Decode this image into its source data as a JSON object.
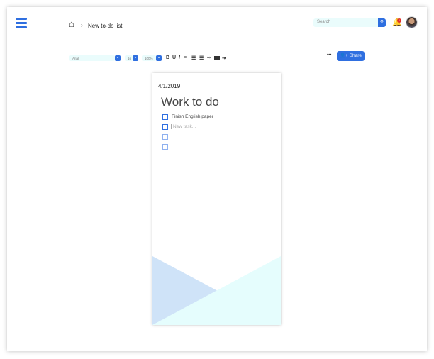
{
  "header": {
    "breadcrumb": "New to-do list",
    "search_placeholder": "Search",
    "notification_count": "1"
  },
  "toolbar": {
    "font": "Arial",
    "size": "16",
    "zoom": "100%",
    "bold": "B",
    "underline": "U",
    "italic": "I",
    "more": "•••",
    "share": "Share"
  },
  "doc": {
    "date": "4/1/2019",
    "title": "Work to do",
    "tasks": [
      {
        "text": "Finish English paper"
      },
      {
        "text": "New task..."
      }
    ]
  },
  "colors": {
    "accent": "#2f6fe0",
    "tri_blue": "#cfe3f8",
    "tri_cyan": "#e5fdfd"
  }
}
